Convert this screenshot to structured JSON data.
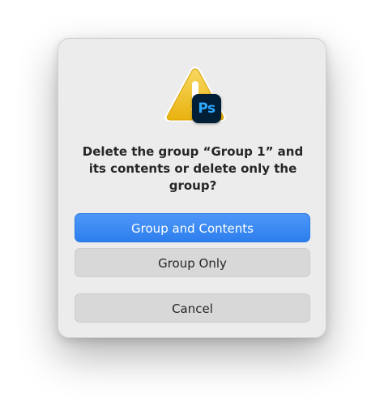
{
  "dialog": {
    "badge_label": "Ps",
    "message": "Delete the group “Group 1” and its contents or delete only the group?",
    "buttons": {
      "group_and_contents": "Group and Contents",
      "group_only": "Group Only",
      "cancel": "Cancel"
    },
    "icons": {
      "alert": "warning-triangle-icon",
      "app": "photoshop-icon"
    },
    "colors": {
      "primary_button": "#3b88f2",
      "warning": "#f1c21b",
      "badge_background": "#001e36",
      "badge_text": "#31a8ff"
    }
  }
}
